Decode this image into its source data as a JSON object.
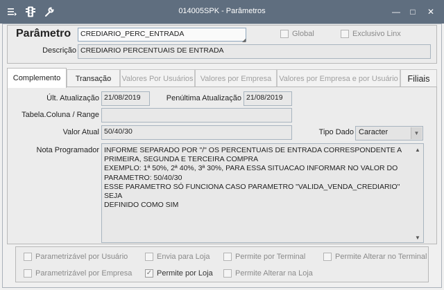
{
  "window": {
    "title": "014005SPK - Parâmetros",
    "minimize_glyph": "—",
    "maximize_glyph": "□",
    "close_glyph": "✕"
  },
  "toolbar_icons": [
    "menu-icon",
    "traffic-light-icon",
    "wrench-icon"
  ],
  "header": {
    "param_label": "Parâmetro",
    "param_value": "CREDIARIO_PERC_ENTRADA",
    "desc_label": "Descrição",
    "desc_value": "CREDIARIO PERCENTUAIS DE ENTRADA",
    "global_label": "Global",
    "exclusive_label": "Exclusivo Linx"
  },
  "tabs": [
    {
      "label": "Complemento"
    },
    {
      "label": "Transação"
    },
    {
      "label": "Valores Por Usuários"
    },
    {
      "label": "Valores por Empresa"
    },
    {
      "label": "Valores por Empresa e por Usuário"
    },
    {
      "label": "Filiais"
    }
  ],
  "complemento": {
    "last_update_label": "Últ. Atualização",
    "last_update_value": "21/08/2019",
    "prev_update_label": "Penúltima Atualização",
    "prev_update_value": "21/08/2019",
    "table_column_label": "Tabela.Coluna / Range",
    "table_column_value": "",
    "current_value_label": "Valor Atual",
    "current_value": "50/40/30",
    "data_type_label": "Tipo Dado",
    "data_type_value": "Caracter",
    "note_label": "Nota Programador",
    "note_text": "INFORME SEPARADO POR \"/\" OS PERCENTUAIS DE ENTRADA CORRESPONDENTE A\nPRIMEIRA, SEGUNDA E TERCEIRA COMPRA\nEXEMPLO: 1ª 50%, 2ª 40%, 3ª 30%, PARA ESSA SITUACAO INFORMAR NO VALOR DO\nPARAMETRO: 50/40/30\nESSE PARAMETRO SÓ FUNCIONA CASO PARAMETRO \"VALIDA_VENDA_CREDIARIO\" SEJA\nDEFINIDO COMO SIM"
  },
  "options": {
    "param_user": "Parametrizável por Usuário",
    "send_store": "Envia para Loja",
    "allow_terminal": "Permite por Terminal",
    "allow_change_terminal": "Permite Alterar no Terminal",
    "param_company": "Parametrizável por Empresa",
    "allow_store": "Permite por Loja",
    "allow_change_store": "Permite Alterar na Loja",
    "allow_store_checked": true
  }
}
